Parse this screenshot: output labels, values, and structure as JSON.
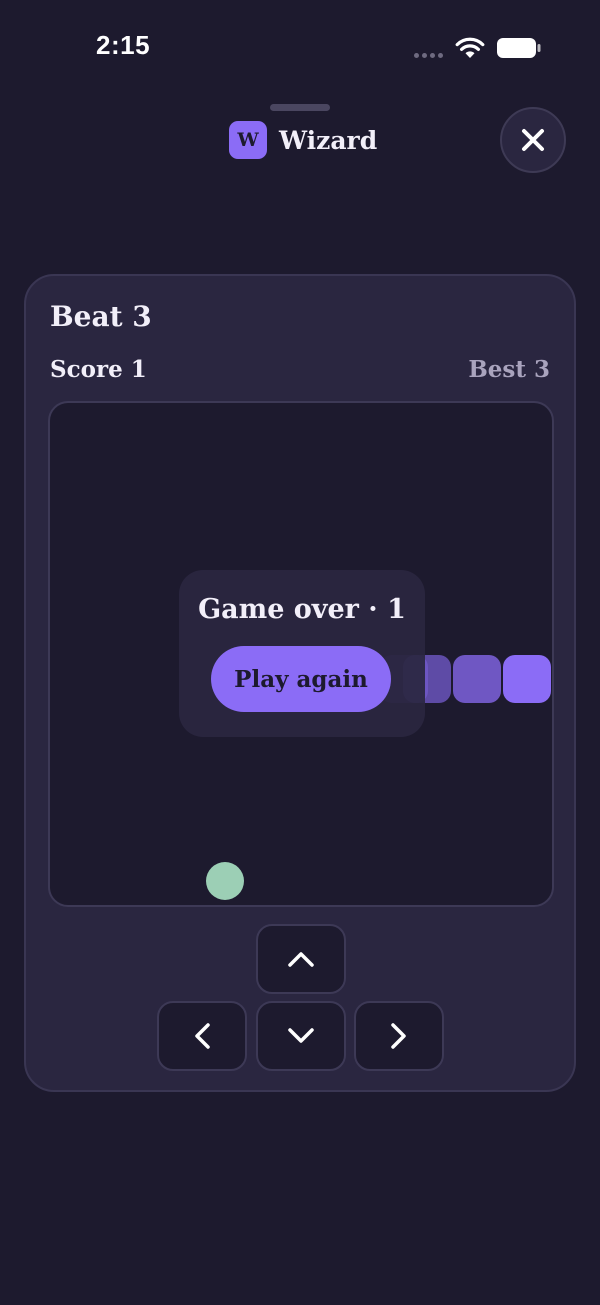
{
  "status_bar": {
    "time": "2:15",
    "signal_icon": "signal-dots-icon",
    "wifi_icon": "wifi-icon",
    "battery_icon": "battery-icon"
  },
  "header": {
    "logo_letter": "W",
    "app_name": "Wizard",
    "close_icon": "close-icon"
  },
  "game": {
    "title": "Beat 3",
    "score_label": "Score 1",
    "best_label": "Best 3",
    "overlay": {
      "title": "Game over · 1",
      "play_again_label": "Play again"
    },
    "snake_color": "#8b6cf6",
    "food_color": "#9ccfb5"
  },
  "controls": {
    "up_icon": "chevron-up-icon",
    "left_icon": "chevron-left-icon",
    "down_icon": "chevron-down-icon",
    "right_icon": "chevron-right-icon"
  },
  "colors": {
    "background": "#1d1a2e",
    "card": "#2a2640",
    "accent": "#8b6cf6",
    "food": "#9ccfb5",
    "muted_text": "#a9a3bd"
  }
}
